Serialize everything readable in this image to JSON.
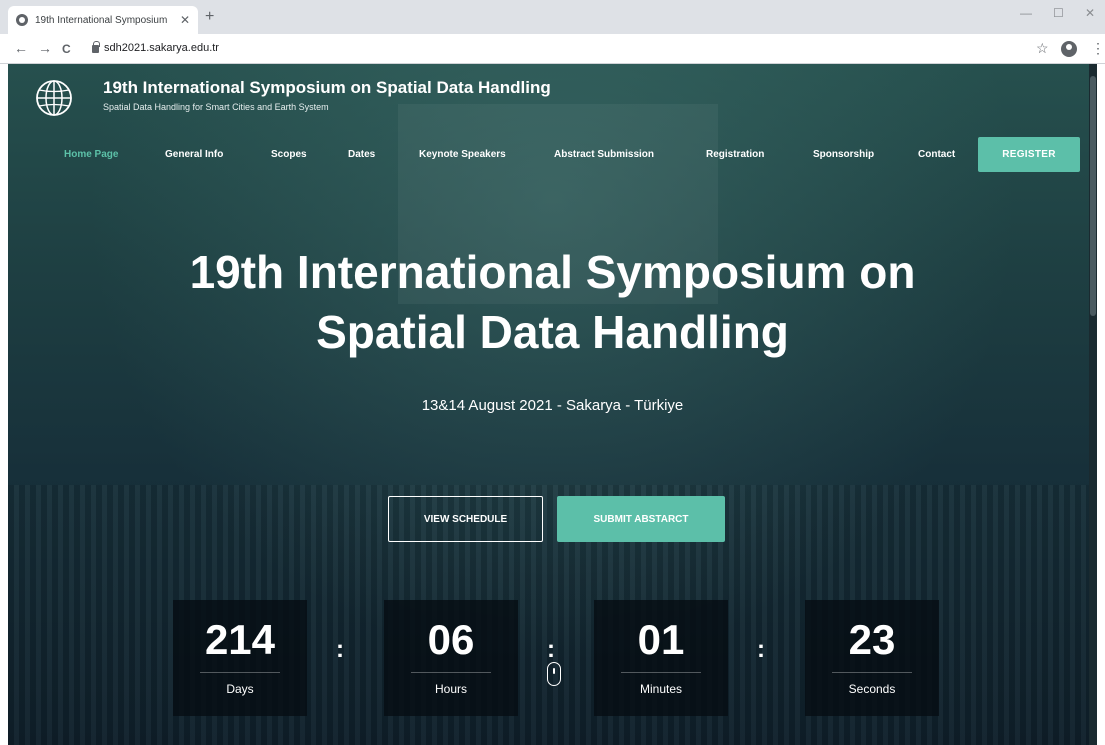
{
  "browser": {
    "tab_title": "19th International Symposium",
    "tab_close": "✕",
    "new_tab": "+",
    "url": "sdh2021.sakarya.edu.tr",
    "minimize": "—",
    "maximize": "☐",
    "close": "✕",
    "back": "←",
    "forward": "→",
    "reload": "C",
    "bookmark": "☆",
    "menu": "⋮"
  },
  "site": {
    "title": "19th International Symposium on Spatial Data Handling",
    "subtitle": "Spatial Data Handling for Smart Cities and Earth System"
  },
  "nav": {
    "items": [
      "Home Page",
      "General Info",
      "Scopes",
      "Dates",
      "Keynote Speakers",
      "Abstract Submission",
      "Registration",
      "Sponsorship",
      "Contact"
    ],
    "active": "Home Page",
    "register": "REGISTER"
  },
  "hero": {
    "title_line1": "19th International Symposium on",
    "title_line2": "Spatial Data Handling",
    "date": "13&14 August 2021 - Sakarya - Türkiye",
    "view_schedule": "VIEW SCHEDULE",
    "submit_abstract": "SUBMIT ABSTARCT"
  },
  "countdown": {
    "days": "214",
    "days_label": "Days",
    "hours": "06",
    "hours_label": "Hours",
    "minutes": "01",
    "minutes_label": "Minutes",
    "seconds": "23",
    "seconds_label": "Seconds",
    "separator": ":"
  },
  "colors": {
    "accent": "#5cbfa9",
    "nav_active": "#5cc1a8"
  }
}
